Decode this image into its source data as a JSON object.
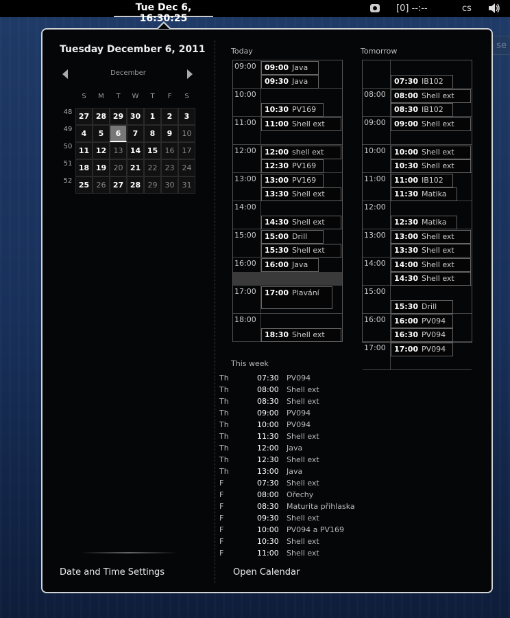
{
  "topbar": {
    "clock": "Tue Dec  6, 16:30:25",
    "keyboard_status": "[0] --:--",
    "language": "cs"
  },
  "desktop": {
    "search_placeholder": "Type to se"
  },
  "calendar": {
    "selected_date_title": "Tuesday December  6, 2011",
    "month": "December",
    "weekdays": [
      "S",
      "M",
      "T",
      "W",
      "T",
      "F",
      "S"
    ],
    "weeks": [
      {
        "num": "48",
        "days": [
          {
            "d": "27",
            "dim": false
          },
          {
            "d": "28",
            "dim": false
          },
          {
            "d": "29",
            "dim": false
          },
          {
            "d": "30",
            "dim": false
          },
          {
            "d": "1",
            "dim": false
          },
          {
            "d": "2",
            "dim": false
          },
          {
            "d": "3",
            "dim": false
          }
        ]
      },
      {
        "num": "49",
        "days": [
          {
            "d": "4",
            "dim": false
          },
          {
            "d": "5",
            "dim": false
          },
          {
            "d": "6",
            "dim": false,
            "today": true
          },
          {
            "d": "7",
            "dim": false
          },
          {
            "d": "8",
            "dim": false
          },
          {
            "d": "9",
            "dim": false
          },
          {
            "d": "10",
            "dim": true
          }
        ]
      },
      {
        "num": "50",
        "days": [
          {
            "d": "11",
            "dim": false
          },
          {
            "d": "12",
            "dim": false
          },
          {
            "d": "13",
            "dim": true
          },
          {
            "d": "14",
            "dim": false
          },
          {
            "d": "15",
            "dim": false
          },
          {
            "d": "16",
            "dim": true
          },
          {
            "d": "17",
            "dim": true
          }
        ]
      },
      {
        "num": "51",
        "days": [
          {
            "d": "18",
            "dim": false
          },
          {
            "d": "19",
            "dim": false
          },
          {
            "d": "20",
            "dim": true
          },
          {
            "d": "21",
            "dim": false
          },
          {
            "d": "22",
            "dim": true
          },
          {
            "d": "23",
            "dim": true
          },
          {
            "d": "24",
            "dim": true
          }
        ]
      },
      {
        "num": "52",
        "days": [
          {
            "d": "25",
            "dim": false
          },
          {
            "d": "26",
            "dim": true
          },
          {
            "d": "27",
            "dim": false
          },
          {
            "d": "28",
            "dim": false
          },
          {
            "d": "29",
            "dim": true
          },
          {
            "d": "30",
            "dim": true
          },
          {
            "d": "31",
            "dim": true
          }
        ]
      }
    ],
    "settings_link": "Date and Time Settings",
    "open_calendar_link": "Open Calendar"
  },
  "today": {
    "title": "Today",
    "hours": [
      "09:00",
      "10:00",
      "11:00",
      "12:00",
      "13:00",
      "14:00",
      "15:00",
      "16:00",
      "17:00",
      "18:00"
    ],
    "events": [
      {
        "time": "09:00",
        "name": "Java",
        "slot": 0,
        "half": 0
      },
      {
        "time": "09:30",
        "name": "Java",
        "slot": 0,
        "half": 1
      },
      {
        "time": "10:30",
        "name": "PV169",
        "slot": 1,
        "half": 1
      },
      {
        "time": "11:00",
        "name": "Shell ext",
        "slot": 2,
        "half": 0
      },
      {
        "time": "12:00",
        "name": "shell ext",
        "slot": 3,
        "half": 0
      },
      {
        "time": "12:30",
        "name": "PV169",
        "slot": 3,
        "half": 1
      },
      {
        "time": "13:00",
        "name": "PV169",
        "slot": 4,
        "half": 0
      },
      {
        "time": "13:30",
        "name": "Shell ext",
        "slot": 4,
        "half": 1
      },
      {
        "time": "14:30",
        "name": "Shell ext",
        "slot": 5,
        "half": 1
      },
      {
        "time": "15:00",
        "name": "Drill",
        "slot": 6,
        "half": 0
      },
      {
        "time": "15:30",
        "name": "Shell ext",
        "slot": 6,
        "half": 1
      },
      {
        "time": "16:00",
        "name": "Java",
        "slot": 7,
        "half": 0
      },
      {
        "time": "17:00",
        "name": "Plavání",
        "slot": 8,
        "half": 0,
        "tall": true
      },
      {
        "time": "18:30",
        "name": "Shell ext",
        "slot": 9,
        "half": 1
      }
    ]
  },
  "tomorrow": {
    "title": "Tomorrow",
    "hours": [
      "",
      "08:00",
      "09:00",
      "10:00",
      "11:00",
      "12:00",
      "13:00",
      "14:00",
      "15:00",
      "16:00",
      "17:00"
    ],
    "events": [
      {
        "time": "07:30",
        "name": "IB102",
        "slot": 0,
        "half": 1
      },
      {
        "time": "08:00",
        "name": "Shell ext",
        "slot": 1,
        "half": 0
      },
      {
        "time": "08:30",
        "name": "IB102",
        "slot": 1,
        "half": 1
      },
      {
        "time": "09:00",
        "name": "Shell ext",
        "slot": 2,
        "half": 0
      },
      {
        "time": "10:00",
        "name": "Shell ext",
        "slot": 3,
        "half": 0
      },
      {
        "time": "10:30",
        "name": "Shell ext",
        "slot": 3,
        "half": 1
      },
      {
        "time": "11:00",
        "name": "IB102",
        "slot": 4,
        "half": 0
      },
      {
        "time": "11:30",
        "name": "Matika",
        "slot": 4,
        "half": 1
      },
      {
        "time": "12:30",
        "name": "Matika",
        "slot": 5,
        "half": 1
      },
      {
        "time": "13:00",
        "name": "Shell ext",
        "slot": 6,
        "half": 0
      },
      {
        "time": "13:30",
        "name": "Shell ext",
        "slot": 6,
        "half": 1
      },
      {
        "time": "14:00",
        "name": "Shell ext",
        "slot": 7,
        "half": 0
      },
      {
        "time": "14:30",
        "name": "Shell ext",
        "slot": 7,
        "half": 1
      },
      {
        "time": "15:30",
        "name": "Drill",
        "slot": 8,
        "half": 1
      },
      {
        "time": "16:00",
        "name": "PV094",
        "slot": 9,
        "half": 0
      },
      {
        "time": "16:30",
        "name": "PV094",
        "slot": 9,
        "half": 1
      },
      {
        "time": "17:00",
        "name": "PV094",
        "slot": 10,
        "half": 0
      }
    ]
  },
  "this_week": {
    "title": "This week",
    "events": [
      {
        "day": "Th",
        "time": "07:30",
        "name": "PV094"
      },
      {
        "day": "Th",
        "time": "08:00",
        "name": "Shell ext"
      },
      {
        "day": "Th",
        "time": "08:30",
        "name": "Shell ext"
      },
      {
        "day": "Th",
        "time": "09:00",
        "name": "PV094"
      },
      {
        "day": "Th",
        "time": "10:00",
        "name": "PV094"
      },
      {
        "day": "Th",
        "time": "11:30",
        "name": "Shell ext"
      },
      {
        "day": "Th",
        "time": "12:00",
        "name": "Java"
      },
      {
        "day": "Th",
        "time": "12:30",
        "name": "Shell ext"
      },
      {
        "day": "Th",
        "time": "13:00",
        "name": "Java"
      },
      {
        "day": "F",
        "time": "07:30",
        "name": "Shell ext"
      },
      {
        "day": "F",
        "time": "08:00",
        "name": "Ořechy"
      },
      {
        "day": "F",
        "time": "08:30",
        "name": "Maturita přihlaska"
      },
      {
        "day": "F",
        "time": "09:30",
        "name": "Shell ext"
      },
      {
        "day": "F",
        "time": "10:00",
        "name": "PV094 a PV169"
      },
      {
        "day": "F",
        "time": "10:30",
        "name": "Shell ext"
      },
      {
        "day": "F",
        "time": "11:00",
        "name": "Shell ext"
      }
    ]
  }
}
